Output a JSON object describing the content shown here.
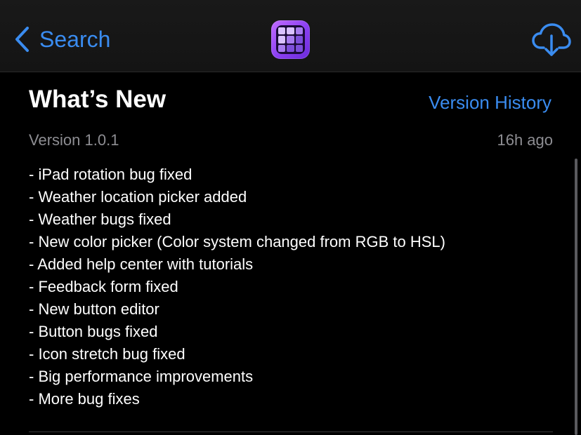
{
  "nav": {
    "back_label": "Search",
    "app_icon": "widget-grid-icon",
    "action_icon": "cloud-download-icon",
    "accent_color": "#3a8cf0"
  },
  "whats_new": {
    "title": "What’s New",
    "version_history_label": "Version History",
    "version": "Version 1.0.1",
    "time_ago": "16h ago",
    "notes": [
      "- iPad rotation bug fixed",
      "- Weather location picker added",
      "- Weather bugs fixed",
      "- New color picker (Color system changed from RGB to HSL)",
      "- Added help center with tutorials",
      "- Feedback form fixed",
      "- New button editor",
      "- Button bugs fixed",
      "- Icon stretch bug fixed",
      "- Big performance improvements",
      "- More bug fixes"
    ]
  }
}
